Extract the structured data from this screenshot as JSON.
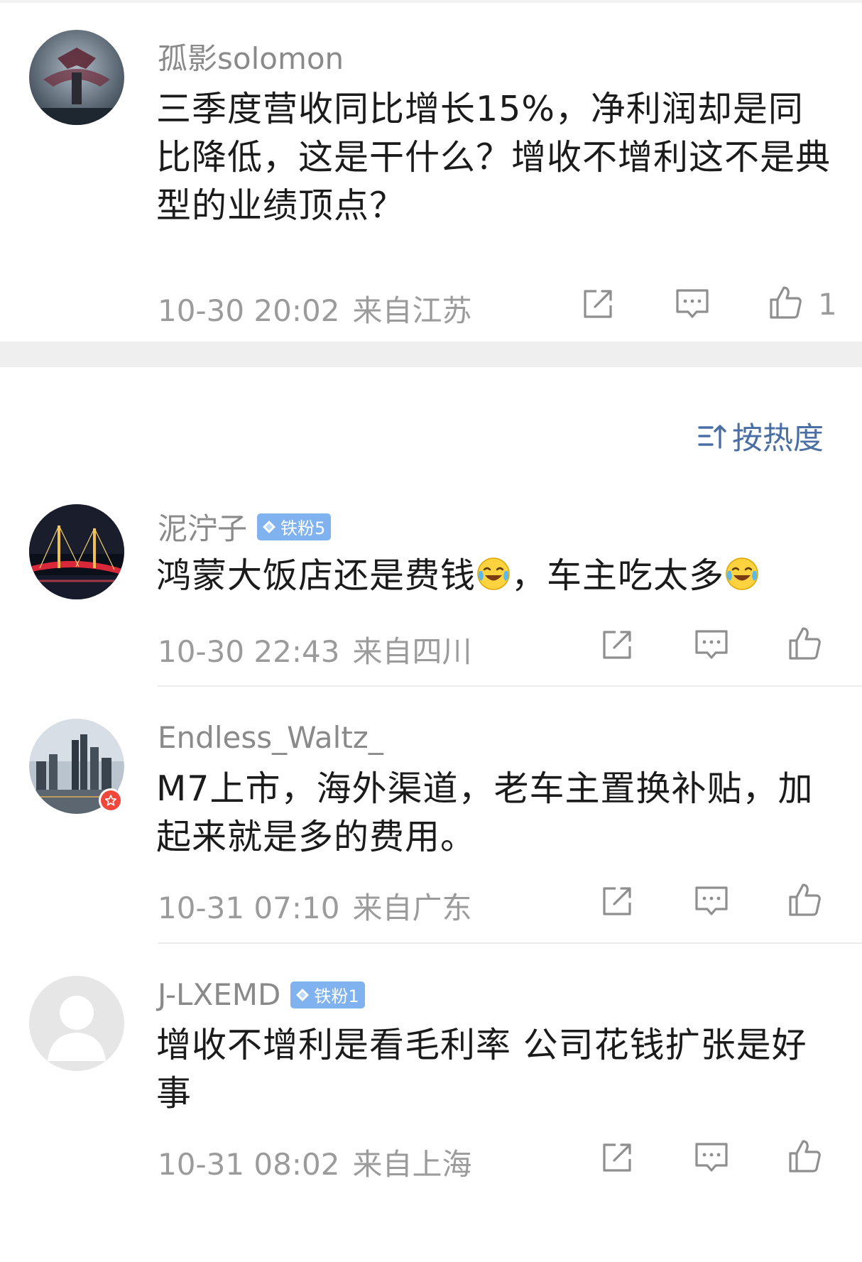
{
  "main_comment": {
    "username": "孤影solomon",
    "text": "三季度营收同比增长15%，净利润却是同比降低，这是干什么？增收不增利这不是典型的业绩顶点？",
    "time": "10-30 20:02",
    "location": "来自江苏",
    "like_count": "1"
  },
  "sort": {
    "label": "按热度"
  },
  "replies": [
    {
      "username": "泥泞子",
      "badge": "铁粉5",
      "text_part1": "鸿蒙大饭店还是费钱",
      "text_part2": "，车主吃太多",
      "time": "10-30 22:43",
      "location": "来自四川"
    },
    {
      "username": "Endless_Waltz_",
      "text": "M7上市，海外渠道，老车主置换补贴，加起来就是多的费用。",
      "time": "10-31 07:10",
      "location": "来自广东"
    },
    {
      "username": "J-LXEMD",
      "badge": "铁粉1",
      "text": "增收不增利是看毛利率 公司花钱扩张是好事",
      "time": "10-31 08:02",
      "location": "来自上海"
    }
  ],
  "icons": [
    "share-icon",
    "comment-icon",
    "like-icon",
    "sort-icon",
    "laugh-cry-emoji"
  ],
  "colors": {
    "badge": "#7fb2ef",
    "sort_text": "#4a6fa5",
    "meta_text": "#9b9b9b"
  }
}
